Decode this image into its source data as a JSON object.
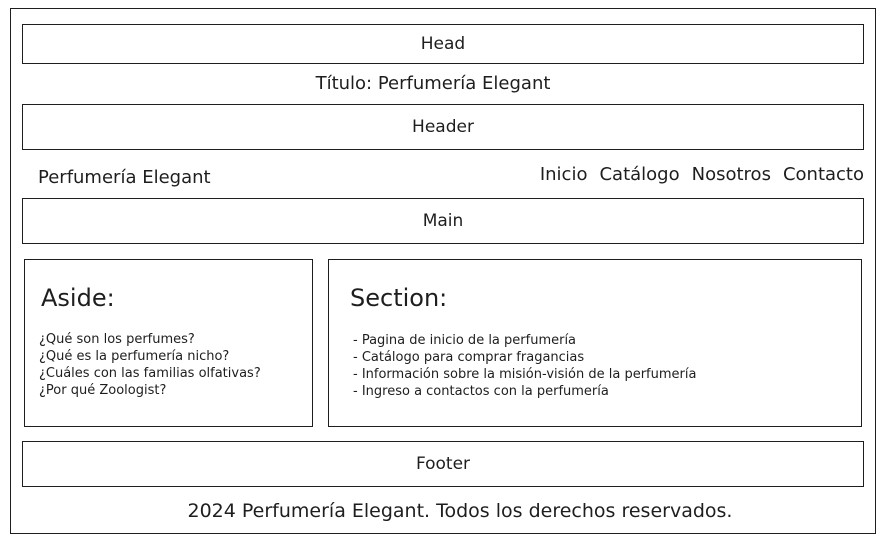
{
  "head": {
    "label": "Head"
  },
  "title_line": "Título: Perfumería Elegant",
  "header": {
    "label": "Header"
  },
  "brand": "Perfumería Elegant",
  "nav": [
    "Inicio",
    "Catálogo",
    "Nosotros",
    "Contacto"
  ],
  "main": {
    "label": "Main"
  },
  "aside": {
    "title": "Aside:",
    "items": [
      "¿Qué son los perfumes?",
      "¿Qué es la perfumería nicho?",
      "¿Cuáles con las familias olfativas?",
      "¿Por qué Zoologist?"
    ]
  },
  "section": {
    "title": "Section:",
    "items": [
      "- Pagina de inicio de la perfumería",
      "- Catálogo para comprar fragancias",
      "- Información sobre la misión-visión de la perfumería",
      "- Ingreso a contactos con la perfumería"
    ]
  },
  "footer": {
    "label": "Footer",
    "copyright": "2024 Perfumería Elegant. Todos los derechos reservados."
  }
}
